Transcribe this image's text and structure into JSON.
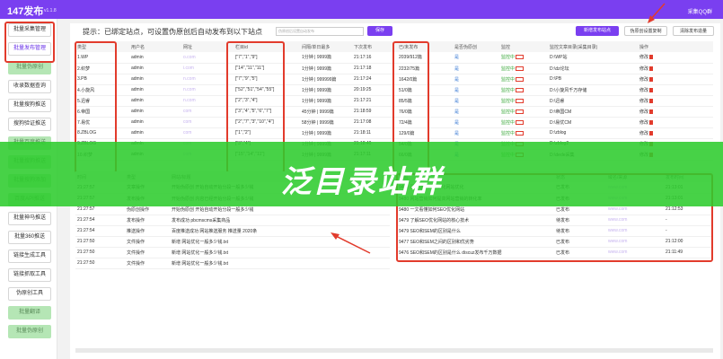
{
  "window": {
    "title": "147发布",
    "version": "v1.1.8",
    "qq_label": "采集QQ群"
  },
  "sidebar": {
    "items": [
      {
        "label": "批量采集管理",
        "state": "normal"
      },
      {
        "label": "批量发布管理",
        "state": "active"
      },
      {
        "label": "批量伪原创",
        "state": "dim"
      },
      {
        "label": "收录数据查询",
        "state": "normal"
      },
      {
        "label": "批量搜狗推送",
        "state": "normal"
      },
      {
        "label": "搜狗验证推送",
        "state": "normal"
      },
      {
        "label": "批量百度推送",
        "state": "dim"
      },
      {
        "label": "批量搜狗推送",
        "state": "dim"
      },
      {
        "label": "批量搜狗添加",
        "state": "dim"
      },
      {
        "label": "百度API推送",
        "state": "dim"
      },
      {
        "label": "批量神马推送",
        "state": "normal"
      },
      {
        "label": "批量360推送",
        "state": "normal"
      },
      {
        "label": "链接生成工具",
        "state": "normal"
      },
      {
        "label": "链接抓取工具",
        "state": "normal"
      },
      {
        "label": "伪原创工具",
        "state": "normal"
      },
      {
        "label": "批量翻译",
        "state": "dim"
      },
      {
        "label": "批量伪原创",
        "state": "dim"
      }
    ]
  },
  "toolbar": {
    "hint": "提示：已绑定站点，可设置伪原创后自动发布到以下站点",
    "hint_input_placeholder": "伪原创后设置自动发布",
    "save_label": "保存",
    "new_site_label": "新增发布站点",
    "copy_label": "伪原创设置复制",
    "clear_label": "清除发布造量"
  },
  "sites": {
    "columns": [
      "类型",
      "用户名",
      "网址",
      "栏目id",
      "间隔/单日最多",
      "下次发布",
      "已/未发布",
      "是否伪原创",
      "监控",
      "监控文章目录(采集目录)",
      "操作"
    ],
    "rows": [
      {
        "type": "1.WP",
        "user": "admin",
        "url": "o.com",
        "cat": "[\"7\",\"1\",\"9\"]",
        "interval": "1分钟 | 9999篇",
        "next": "21:17:16",
        "count": "2039/912篇",
        "pseudo": "是",
        "monitor": "监控中",
        "dir": "D:\\WP站",
        "op": "修改"
      },
      {
        "type": "2.织梦",
        "user": "admin",
        "url": "i.com",
        "cat": "[\"14\",\"11\",\"11\"]",
        "interval": "1分钟 | 9999篇",
        "next": "21:17:18",
        "count": "2232/75篇",
        "pseudo": "是",
        "monitor": "监控中",
        "dir": "D:\\dz论坛",
        "op": "修改"
      },
      {
        "type": "3.PB",
        "user": "admin",
        "url": "n.com",
        "cat": "[\"7\",\"9\",\"5\"]",
        "interval": "1分钟 | 999999篇",
        "next": "21:17:24",
        "count": "1642/0篇",
        "pseudo": "是",
        "monitor": "监控中",
        "dir": "D:\\PB",
        "op": "修改"
      },
      {
        "type": "4.小旋风",
        "user": "admin",
        "url": "n.com",
        "cat": "[\"52\",\"51\",\"54\",\"55\"]",
        "interval": "1分钟 | 9999篇",
        "next": "20:19:25",
        "count": "51/0篇",
        "pseudo": "是",
        "monitor": "监控中",
        "dir": "D:\\小旋风千万存储",
        "op": "修改"
      },
      {
        "type": "5.迅睿",
        "user": "admin",
        "url": "n.com",
        "cat": "[\"2\",\"3\",\"4\"]",
        "interval": "1分钟 | 9999篇",
        "next": "21:17:21",
        "count": "85/5篇",
        "pseudo": "是",
        "monitor": "监控中",
        "dir": "D:\\迅睿",
        "op": "修改"
      },
      {
        "type": "6.帝国",
        "user": "admin",
        "url": "com",
        "cat": "[\"3\",\"4\",\"5\",\"6\",\"7\"]",
        "interval": "45分钟 | 9999篇",
        "next": "21:18:59",
        "count": "76/0篇",
        "pseudo": "是",
        "monitor": "监控中",
        "dir": "D:\\帝国CM",
        "op": "修改"
      },
      {
        "type": "7.易优",
        "user": "admin",
        "url": "com",
        "cat": "[\"2\",\"7\",\"3\",\"10\",\"4\"]",
        "interval": "58分钟 | 9999篇",
        "next": "21:17:08",
        "count": "72/4篇",
        "pseudo": "是",
        "monitor": "监控中",
        "dir": "D:\\易优CM",
        "op": "修改"
      },
      {
        "type": "8.ZBLOG",
        "user": "admin",
        "url": "com",
        "cat": "[\"1\",\"2\"]",
        "interval": "1分钟 | 9999篇",
        "next": "21:18:11",
        "count": "129/0篇",
        "pseudo": "是",
        "monitor": "监控中",
        "dir": "D:\\zblog",
        "op": "修改"
      },
      {
        "type": "9.ZBLOG",
        "user": "admin",
        "url": "com",
        "cat": "[\"3\",\"4\"]",
        "interval": "1分钟 | 9999篇",
        "next": "21:18:40",
        "count": "54/0篇",
        "pseudo": "是",
        "monitor": "监控中",
        "dir": "D:\\zblog2",
        "op": "修改"
      },
      {
        "type": "10.织梦",
        "user": "admin",
        "url": "com",
        "cat": "[\"15\",\"14\",\"11\"]",
        "interval": "1分钟 | 9999篇",
        "next": "21:17:11",
        "count": "66/0篇",
        "pseudo": "是",
        "monitor": "监控中",
        "dir": "D:\\dede采集",
        "op": "修改"
      }
    ]
  },
  "logs": {
    "columns": [
      "时间",
      "类型",
      "网站/标题"
    ],
    "rows": [
      {
        "time": "21:27:57",
        "type": "文章操作",
        "text": "开始伪原创 开始自动开始分段一般多少钱"
      },
      {
        "time": "21:27:57",
        "type": "发布操作",
        "text": "开始伪原创 内容已经开始分段一般多少钱"
      },
      {
        "time": "21:27:57",
        "type": "伪原创操作",
        "text": "开始伪原创 开始自动开始分段一般多少钱"
      },
      {
        "time": "21:27:54",
        "type": "发布操作",
        "text": "发布成功 pbcmscms采集商品"
      },
      {
        "time": "21:27:54",
        "type": "推送操作",
        "text": "百度推送成功 网站推送服务 推送量 2020条"
      },
      {
        "time": "21:27:50",
        "type": "文件操作",
        "text": "新增 网站优化一般多少钱.txt"
      },
      {
        "time": "21:27:50",
        "type": "文件操作",
        "text": "新增 网站优化一般多少钱.txt"
      },
      {
        "time": "21:27:50",
        "type": "文件操作",
        "text": "新增 网站优化一般多少钱.txt"
      }
    ]
  },
  "published": {
    "columns": [
      "标题",
      "状态",
      "域名/来源",
      "发布时间"
    ],
    "rows": [
      {
        "title": "9481 网站建设网站优化网站优化",
        "status": "已发布",
        "domain": "www.com",
        "time": "21:13:01"
      },
      {
        "title": "9480 网站营销如何提高网站营销的转化率",
        "status": "已发布",
        "domain": "www.com",
        "time": "21:13:01"
      },
      {
        "title": "9480 一文看懂如何SEO优化网站",
        "status": "已发布",
        "domain": "www.com",
        "time": "21:12:53"
      },
      {
        "title": "9479 了解SEO优化网站的核心技术",
        "status": "待发布",
        "domain": "www.com",
        "time": "-"
      },
      {
        "title": "9479 SEO和SEM的区别是什么",
        "status": "待发布",
        "domain": "www.com",
        "time": "-"
      },
      {
        "title": "9477 SEO和SEM之间的区别和优劣势",
        "status": "已发布",
        "domain": "www.com",
        "time": "21:12:00"
      },
      {
        "title": "9476 SEO和SEM的区别是什么 discuz发布千万数据",
        "status": "已发布",
        "domain": "www.com",
        "time": "21:11:49"
      }
    ]
  },
  "banner": {
    "text": "泛目录站群"
  },
  "colors": {
    "accent": "#7a3ff0",
    "highlight": "#e23b2c",
    "banner": "#2ecc2e",
    "dim_button": "#b5e6b5"
  }
}
